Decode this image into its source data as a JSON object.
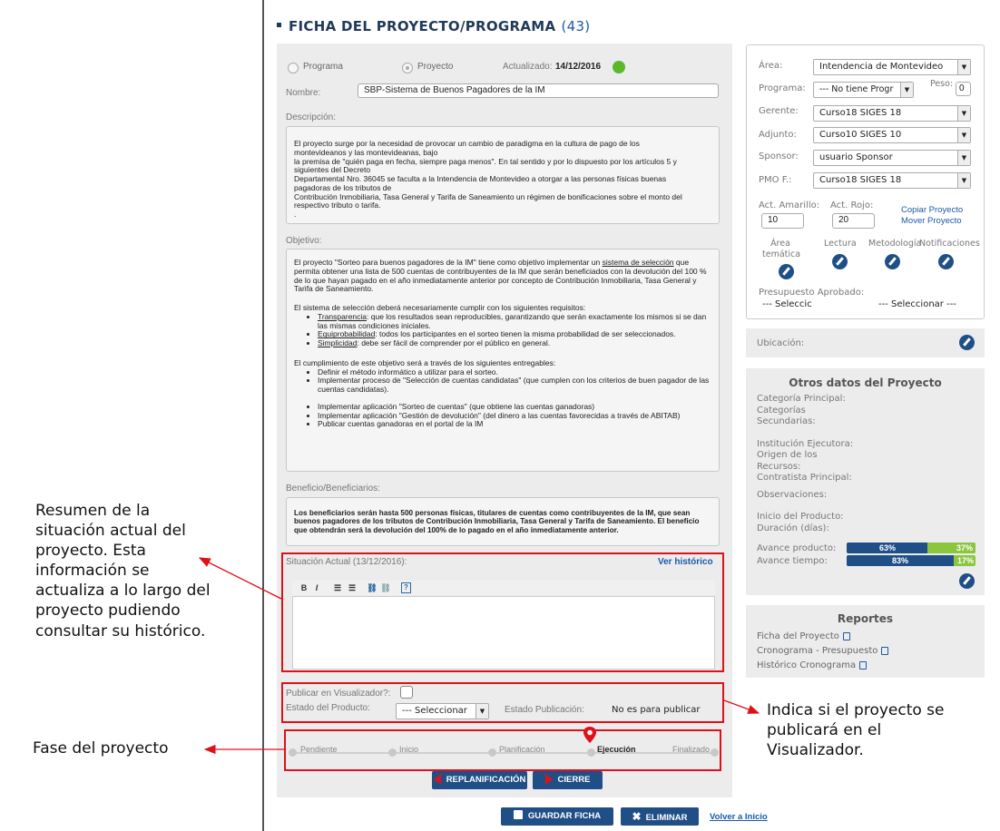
{
  "header": {
    "title": "FICHA DEL PROYECTO/PROGRAMA",
    "count": "(43)"
  },
  "type_selector": {
    "programa": "Programa",
    "proyecto": "Proyecto",
    "actualizado_label": "Actualizado:",
    "actualizado_date": "14/12/2016"
  },
  "nombre": {
    "label": "Nombre:",
    "value": "SBP-Sistema de Buenos Pagadores de la IM"
  },
  "descripcion": {
    "label": "Descripción:",
    "lines": [
      "El proyecto surge por la necesidad de provocar un cambio de paradigma en la cultura de pago de los",
      "montevideanos y las montevideanas, bajo",
      "la premisa de \"quién paga en fecha, siempre paga menos\". En tal sentido y por lo dispuesto por los artículos 5 y",
      "siguientes del Decreto",
      "Departamental Nro. 36045 se faculta a la Intendencia de Montevideo a otorgar a las personas físicas buenas",
      "pagadoras de los tributos de",
      "Contribución Inmobiliaria, Tasa General y Tarifa de Saneamiento un régimen de bonificaciones sobre el monto del",
      "respectivo tributo o tarifa.",
      "."
    ]
  },
  "objetivo": {
    "label": "Objetivo:",
    "intro_a": "El proyecto \"Sorteo para buenos pagadores de la IM\" tiene como objetivo implementar un ",
    "intro_link": "sistema de selección",
    "intro_b": " que permita obtener una lista de 500 cuentas de contribuyentes de la IM que serán beneficiados con la devolución del 100 % de lo que hayan pagado en el año inmediatamente anterior por concepto de Contribución Inmobiliaria, Tasa General y Tarifa de Saneamiento.",
    "req_intro": "El sistema de selección deberá necesariamente cumplir con los siguientes requisitos:",
    "requisitos": [
      {
        "term": "Transparencia",
        "text": ": que los resultados sean reproducibles, garantizando que serán exactamente los mismos si se dan las mismas condiciones iniciales."
      },
      {
        "term": "Equiprobabilidad",
        "text": ": todos los participantes en el sorteo tienen la misma probabilidad de ser seleccionados."
      },
      {
        "term": "Simplicidad",
        "text": ": debe ser fácil de comprender por el público en general."
      }
    ],
    "ent_intro": "El cumplimiento de este objetivo será a través de los siguientes entregables:",
    "entregables_a": [
      "Definir el método informático a utilizar para el sorteo.",
      "Implementar proceso de \"Selección de cuentas candidatas\" (que cumplen con los criterios de buen pagador de las cuentas candidatas)."
    ],
    "entregables_b": [
      "Implementar aplicación \"Sorteo de cuentas\" (que obtiene las cuentas ganadoras)",
      "Implementar aplicación \"Gestión de devolución\" (del dinero a las cuentas favorecidas a través de ABITAB)",
      "Publicar cuentas ganadoras en el portal de la IM"
    ]
  },
  "beneficio": {
    "label": "Beneficio/Beneficiarios:",
    "text": "Los beneficiarios serán hasta 500 personas físicas, titulares de cuentas como contribuyentes de la IM, que sean buenos pagadores de los tributos de Contribución Inmobiliaria, Tasa General y Tarifa de Saneamiento. El beneficio que obtendrán será la devolución del 100% de lo pagado en el año inmediatamente anterior."
  },
  "situacion": {
    "label": "Situación Actual (13/12/2016):",
    "historico_link": "Ver histórico",
    "toolbar": [
      "B",
      "I"
    ]
  },
  "publicar": {
    "label": "Publicar en Visualizador?:",
    "estado_producto_label": "Estado del Producto:",
    "estado_producto_value": "--- Seleccionar",
    "estado_pub_label": "Estado Publicación:",
    "estado_pub_value": "No es para publicar"
  },
  "fases": [
    "Pendiente",
    "Inicio",
    "Planificación",
    "Ejecución",
    "Finalizado"
  ],
  "fase_actual": "Ejecución",
  "actions": {
    "replanificacion": "REPLANIFICACIÓN",
    "cierre": "CIERRE",
    "guardar": "GUARDAR FICHA",
    "eliminar": "ELIMINAR",
    "volver": "Volver a Inicio"
  },
  "side": {
    "area_label": "Área:",
    "area_value": "Intendencia de Montevideo",
    "programa_label": "Programa:",
    "programa_value": "--- No tiene Progr",
    "peso_label": "Peso:",
    "peso_value": "0",
    "gerente_label": "Gerente:",
    "gerente_value": "Curso18 SIGES 18",
    "adjunto_label": "Adjunto:",
    "adjunto_value": "Curso10 SIGES 10",
    "sponsor_label": "Sponsor:",
    "sponsor_value": "usuario Sponsor",
    "pmo_label": "PMO F.:",
    "pmo_value": "Curso18 SIGES 18",
    "amarillo_label": "Act. Amarillo:",
    "amarillo_value": "10",
    "rojo_label": "Act. Rojo:",
    "rojo_value": "20",
    "copiar": "Copiar Proyecto",
    "mover": "Mover Proyecto",
    "icons": [
      "Área temática",
      "Lectura",
      "Metodología",
      "Notificaciones"
    ],
    "presupuesto_label": "Presupuesto Aprobado:",
    "presupuesto_a": "--- Seleccic",
    "presupuesto_b": "--- Seleccionar ---",
    "ubicacion_label": "Ubicación:"
  },
  "otros": {
    "title": "Otros datos del Proyecto",
    "fields": [
      "Categoría Principal:",
      "Categorías",
      "Secundarias:",
      "",
      "Institución Ejecutora:",
      "Origen de los",
      "Recursos:",
      "Contratista Principal:",
      "",
      "Observaciones:",
      "",
      "Inicio del Producto:",
      "Duración (días):"
    ],
    "avance_producto_label": "Avance producto:",
    "avance_producto_a": "63%",
    "avance_producto_b": "37%",
    "avance_producto_fraction": 0.63,
    "avance_tiempo_label": "Avance tiempo:",
    "avance_tiempo_a": "83%",
    "avance_tiempo_b": "17%",
    "avance_tiempo_fraction": 0.83
  },
  "reportes": {
    "title": "Reportes",
    "items": [
      "Ficha del Proyecto",
      "Cronograma - Presupuesto",
      "Histórico Cronograma"
    ]
  },
  "annotations": {
    "left1": [
      "Resumen de la",
      "situación actual del",
      "proyecto. Esta",
      "información se",
      "actualiza a lo largo del",
      "proyecto pudiendo",
      "consultar su histórico."
    ],
    "left2": "Fase del proyecto",
    "right1": [
      "Indica si el proyecto se",
      "publicará en el",
      "Visualizador."
    ]
  },
  "colors": {
    "accent": "#1f4f86",
    "highlight": "#e0101a",
    "green": "#5cb82b"
  }
}
